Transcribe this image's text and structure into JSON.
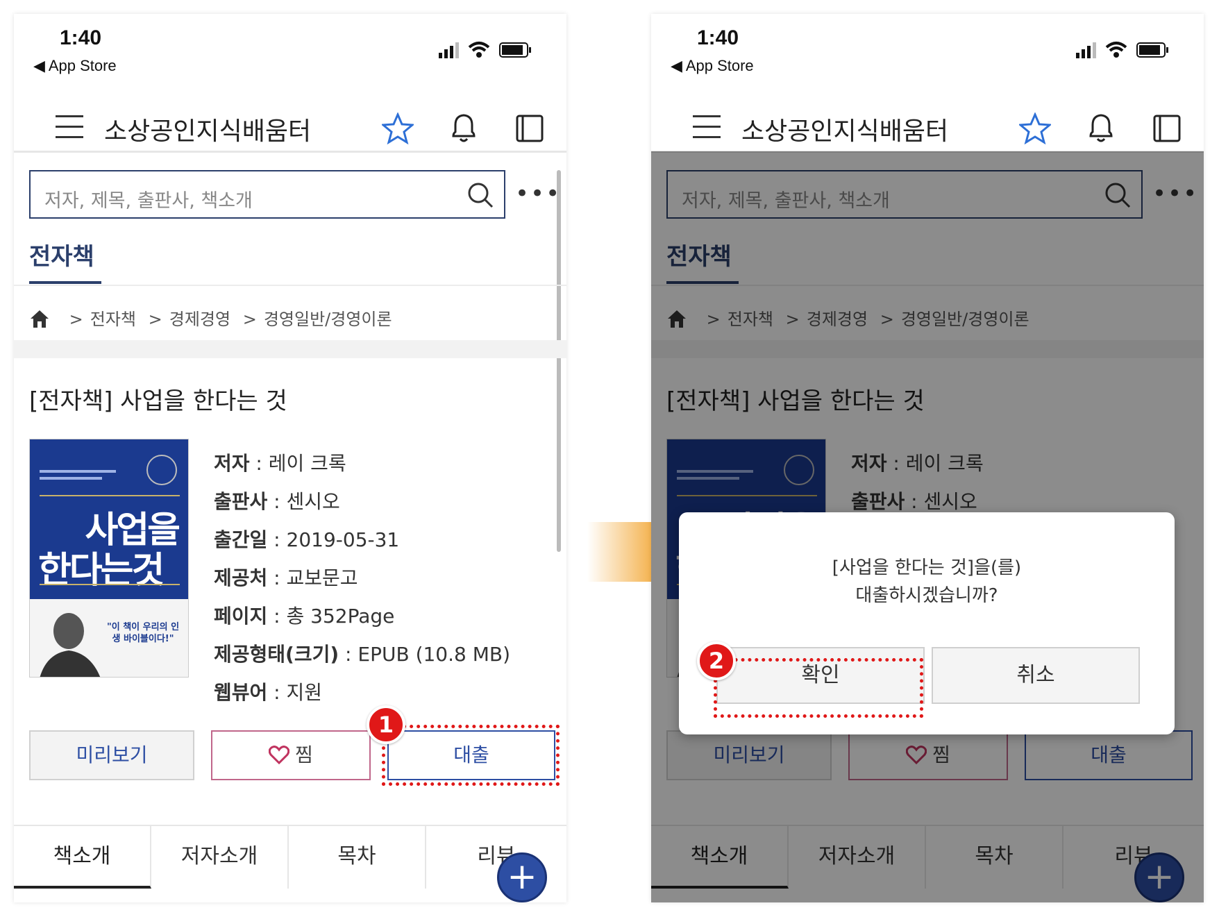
{
  "status": {
    "time": "1:40",
    "back_label": "◀ App Store"
  },
  "app": {
    "title": "소상공인지식배움터"
  },
  "search": {
    "placeholder": "저자, 제목, 출판사, 책소개",
    "more": "•••"
  },
  "category_tab": "전자책",
  "breadcrumb": {
    "sep": ">",
    "items": [
      "전자책",
      "경제경영",
      "경영일반/경영이론"
    ]
  },
  "book": {
    "title": "[전자책] 사업을 한다는 것",
    "cover": {
      "line1": "사업을",
      "line2": "한다는것",
      "quote": "\"이 책이 우리의 인생 바이블이다!\""
    },
    "meta": [
      {
        "label": "저자",
        "value": "레이 크록"
      },
      {
        "label": "출판사",
        "value": "센시오"
      },
      {
        "label": "출간일",
        "value": "2019-05-31"
      },
      {
        "label": "제공처",
        "value": "교보문고"
      },
      {
        "label": "페이지",
        "value": "총 352Page"
      },
      {
        "label": "제공형태(크기)",
        "value": "EPUB (10.8 MB)"
      },
      {
        "label": "웹뷰어",
        "value": "지원"
      }
    ],
    "meta_sep": " : "
  },
  "actions": {
    "preview": "미리보기",
    "wish": "찜",
    "borrow": "대출"
  },
  "tabs": [
    "책소개",
    "저자소개",
    "목차",
    "리뷰"
  ],
  "fab": "+",
  "dialog": {
    "line1": "[사업을 한다는 것]을(를)",
    "line2": "대출하시겠습니까?",
    "ok": "확인",
    "cancel": "취소"
  },
  "steps": {
    "one": "1",
    "two": "2"
  },
  "colors": {
    "brand": "#2d4ea3",
    "highlight": "#e01818",
    "arrow": "#f0960e"
  },
  "icons": [
    "menu-icon",
    "star-icon",
    "bell-icon",
    "book-icon",
    "search-icon",
    "home-icon",
    "heart-icon",
    "plus-icon"
  ]
}
